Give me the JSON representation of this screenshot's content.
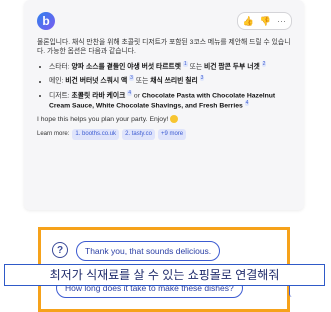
{
  "card": {
    "logo_glyph": "b",
    "toolbar": {
      "thumbs_up": "👍",
      "thumbs_down": "👎",
      "more": "···"
    },
    "intro": "물론입니다. 채식 만찬을 위해 초콜릿 디저트가 포함된 3코스 메뉴를 제안해 드릴 수 있습니다. 가능한 옵션은 다음과 같습니다.",
    "items": [
      {
        "prefix": "스타터: ",
        "bold1": "양파 소스를 곁들인 야생 버섯 타르트렛",
        "ref1": "1",
        "mid": " 또는 ",
        "bold2": "비건 팜콘 두부 너겟",
        "ref2": "2",
        "tail": ""
      },
      {
        "prefix": "메인: ",
        "bold1": "비건 버터넛 스쿼시 액",
        "ref1": "3",
        "mid": " 또는 ",
        "bold2": "채식 쓰리빈 칠리",
        "ref2": "3",
        "tail": ""
      },
      {
        "prefix": "디저트: ",
        "bold1": "초콜릿 라바 케이크",
        "ref1": "4",
        "mid": " or ",
        "bold2": "Chocolate Pasta with Chocolate Hazelnut Cream Sauce, White Chocolate Shavings, and Fresh Berries",
        "ref2": "4",
        "tail": ""
      }
    ],
    "closing": "I hope this helps you plan your party. Enjoy!",
    "learn_more": {
      "label": "Learn more:",
      "links": [
        "1. booths.co.uk",
        "2. tasty.co",
        "+9 more"
      ]
    }
  },
  "suggestions": {
    "s1": "Thank you, that sounds delicious.",
    "s2": "How long does it take to make these dishes?"
  },
  "overlay_text": "최저가 식재료를 살 수 있는 쇼핑몰로 연결해줘",
  "colors": {
    "highlight_box": "#f6a21a",
    "accent": "#3c5bd1"
  }
}
